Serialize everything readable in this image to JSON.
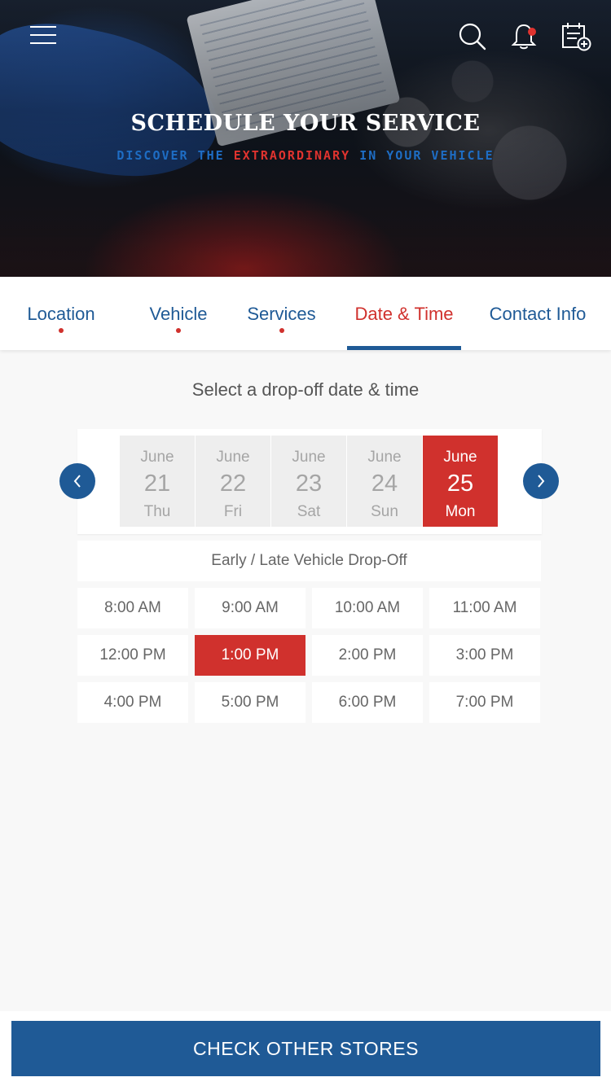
{
  "header": {
    "title": "SCHEDULE YOUR SERVICE",
    "subtitle_pre": "DISCOVER THE",
    "subtitle_accent": "EXTRAORDINARY",
    "subtitle_post": "IN YOUR VEHICLE",
    "icons": [
      "menu-icon",
      "search-icon",
      "bell-icon",
      "calendar-add-icon"
    ],
    "colors": {
      "blue": "#1e6dc4",
      "red": "#e0332f"
    }
  },
  "tabs": [
    {
      "label": "Location",
      "completed": true
    },
    {
      "label": "Vehicle",
      "completed": true
    },
    {
      "label": "Services",
      "completed": true
    },
    {
      "label": "Date & Time",
      "active": true
    },
    {
      "label": "Contact Info"
    }
  ],
  "main": {
    "title": "Select a drop-off date & time",
    "dates": [
      {
        "month": "June",
        "day": "21",
        "weekday": "Thu"
      },
      {
        "month": "June",
        "day": "22",
        "weekday": "Fri"
      },
      {
        "month": "June",
        "day": "23",
        "weekday": "Sat"
      },
      {
        "month": "June",
        "day": "24",
        "weekday": "Sun"
      },
      {
        "month": "June",
        "day": "25",
        "weekday": "Mon",
        "selected": true
      }
    ],
    "early_late_label": "Early / Late Vehicle Drop-Off",
    "times": [
      "8:00 AM",
      "9:00 AM",
      "10:00 AM",
      "11:00 AM",
      "12:00 PM",
      "1:00 PM",
      "2:00 PM",
      "3:00 PM",
      "4:00 PM",
      "5:00 PM",
      "6:00 PM",
      "7:00 PM"
    ],
    "selected_time": "1:00 PM"
  },
  "footer": {
    "button_label": "CHECK OTHER STORES"
  },
  "colors": {
    "primary": "#1f5a96",
    "accent": "#d0312d",
    "background": "#f8f8f8"
  }
}
